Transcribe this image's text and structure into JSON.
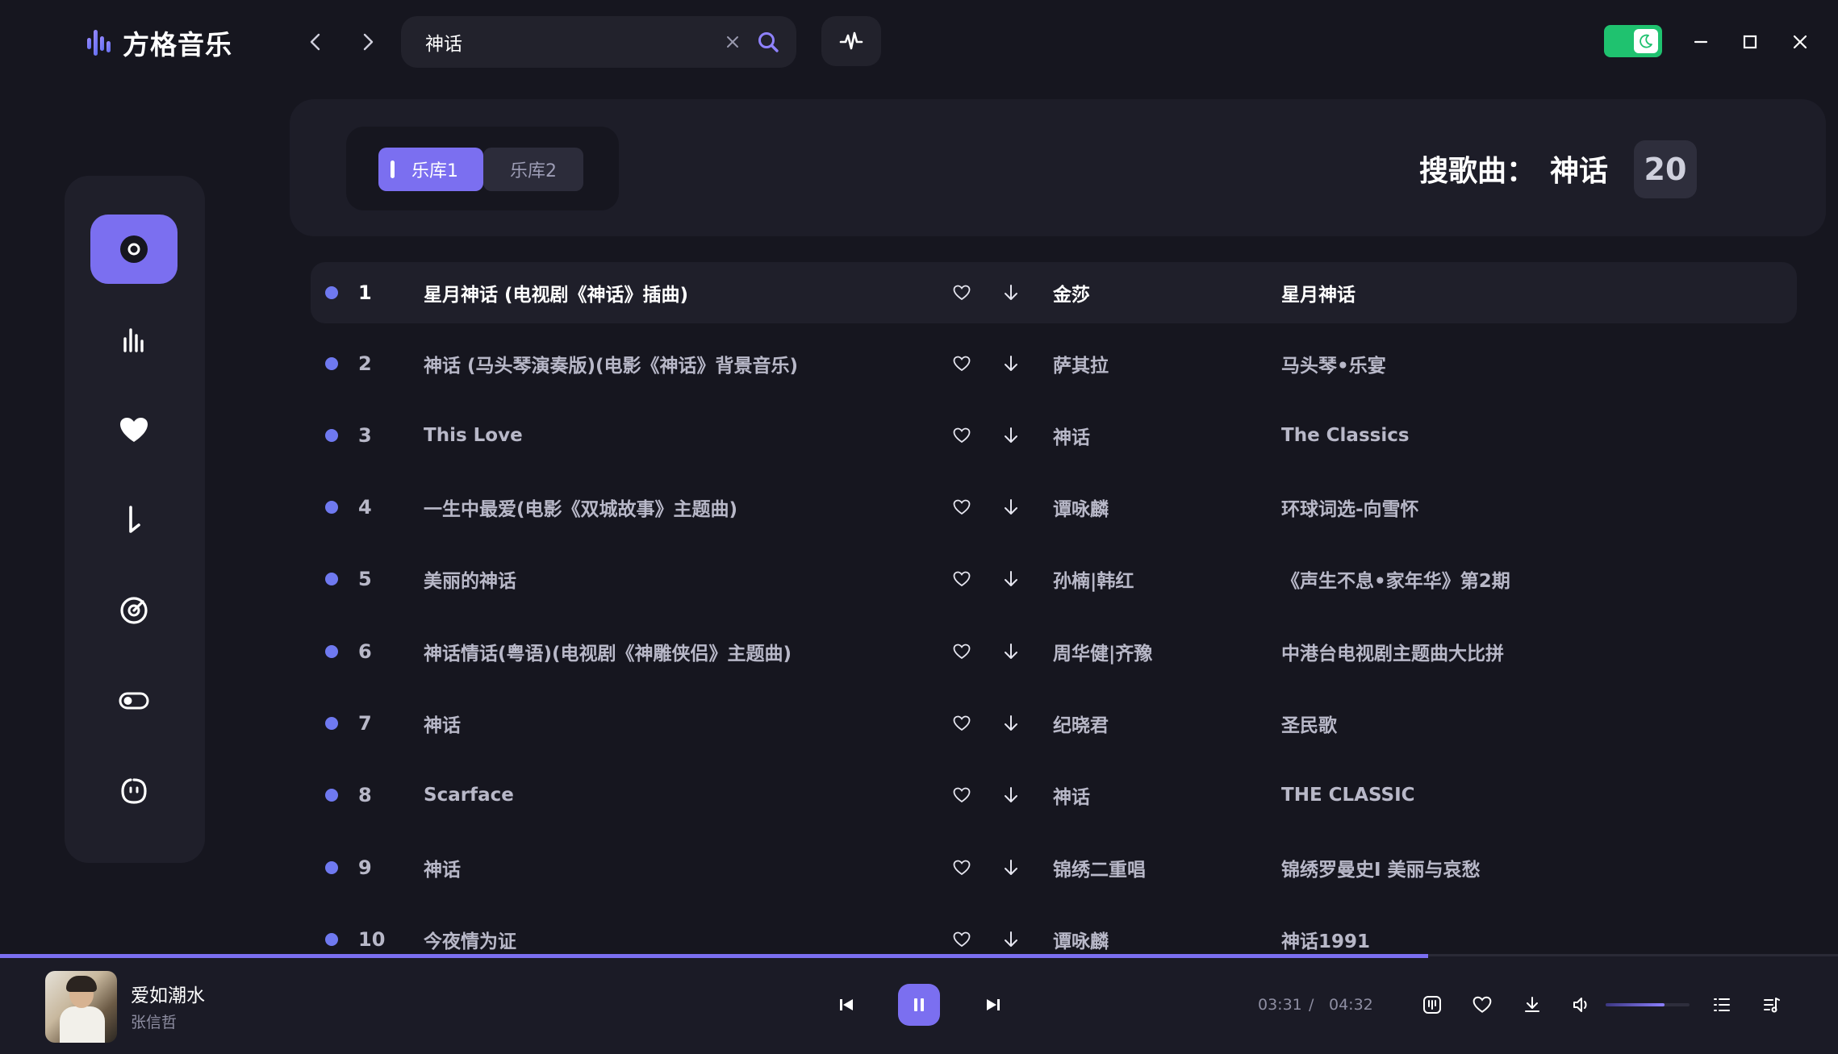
{
  "app": {
    "name": "方格音乐",
    "accent": "#7b6ff0"
  },
  "search": {
    "value": "神话",
    "placeholder": ""
  },
  "header": {
    "tabs": [
      {
        "label": "乐库1",
        "active": true
      },
      {
        "label": "乐库2",
        "active": false
      }
    ],
    "search_label": "搜歌曲：",
    "keyword": "神话",
    "count": "20"
  },
  "sidebar": {
    "items": [
      {
        "icon": "disc-icon",
        "active": true
      },
      {
        "icon": "equalizer-icon",
        "active": false
      },
      {
        "icon": "heart-icon",
        "active": false
      },
      {
        "icon": "music-note-icon",
        "active": false
      },
      {
        "icon": "target-icon",
        "active": false
      },
      {
        "icon": "toggle-icon",
        "active": false
      },
      {
        "icon": "smile-icon",
        "active": false
      }
    ]
  },
  "songs": [
    {
      "index": "1",
      "title": "星月神话 (电视剧《神话》插曲)",
      "artist": "金莎",
      "album": "星月神话"
    },
    {
      "index": "2",
      "title": "神话 (马头琴演奏版)(电影《神话》背景音乐)",
      "artist": "萨其拉",
      "album": "马头琴•乐宴"
    },
    {
      "index": "3",
      "title": "This Love",
      "artist": "神话",
      "album": "The Classics"
    },
    {
      "index": "4",
      "title": "一生中最爱(电影《双城故事》主题曲)",
      "artist": "谭咏麟",
      "album": "环球词选-向雪怀"
    },
    {
      "index": "5",
      "title": "美丽的神话",
      "artist": "孙楠|韩红",
      "album": "《声生不息•家年华》第2期"
    },
    {
      "index": "6",
      "title": "神话情话(粤语)(电视剧《神雕侠侣》主题曲)",
      "artist": "周华健|齐豫",
      "album": "中港台电视剧主题曲大比拼"
    },
    {
      "index": "7",
      "title": "神话",
      "artist": "纪晓君",
      "album": "圣民歌"
    },
    {
      "index": "8",
      "title": "Scarface",
      "artist": "神话",
      "album": "THE CLASSIC"
    },
    {
      "index": "9",
      "title": "神话",
      "artist": "锦绣二重唱",
      "album": "锦绣罗曼史Ⅰ 美丽与哀愁"
    },
    {
      "index": "10",
      "title": "今夜情为证",
      "artist": "谭咏麟",
      "album": "神话1991"
    }
  ],
  "player": {
    "title": "爱如潮水",
    "artist": "张信哲",
    "current_time": "03:31",
    "separator": "/",
    "total_time": "04:32",
    "progress": 0.777,
    "volume": 0.7
  }
}
